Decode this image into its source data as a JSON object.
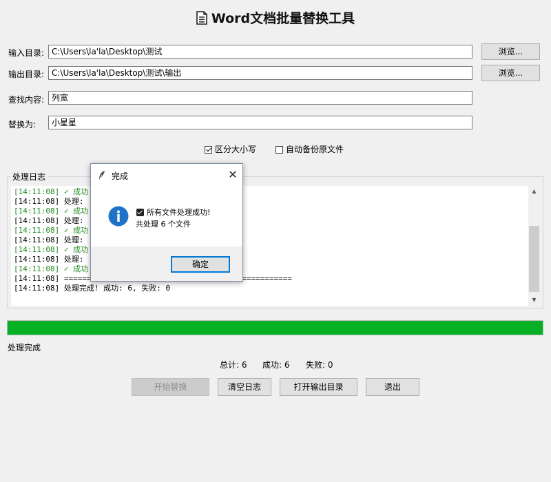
{
  "header": {
    "title": "Word文档批量替换工具",
    "icon": "document-icon"
  },
  "form": {
    "input_dir": {
      "label": "输入目录:",
      "value": "C:\\Users\\la'la\\Desktop\\测试"
    },
    "output_dir": {
      "label": "输出目录:",
      "value": "C:\\Users\\la'la\\Desktop\\测试\\输出"
    },
    "find": {
      "label": "查找内容:",
      "value": "列宽"
    },
    "replace": {
      "label": "替换为:",
      "value": "小星星"
    },
    "browse_label": "浏览...",
    "case_sensitive": {
      "label": "区分大小写",
      "checked": true
    },
    "auto_backup": {
      "label": "自动备份原文件",
      "checked": false
    }
  },
  "log": {
    "title": "处理日志",
    "lines": [
      {
        "time": "[14:11:08]",
        "text": " ✓ 成功",
        "kind": "ok"
      },
      {
        "time": "[14:11:08]",
        "text": " 处理:",
        "kind": "normal"
      },
      {
        "time": "[14:11:08]",
        "text": " ✓ 成功",
        "kind": "ok"
      },
      {
        "time": "[14:11:08]",
        "text": " 处理:",
        "kind": "normal"
      },
      {
        "time": "[14:11:08]",
        "text": " ✓ 成功",
        "kind": "ok"
      },
      {
        "time": "[14:11:08]",
        "text": " 处理:",
        "kind": "normal"
      },
      {
        "time": "[14:11:08]",
        "text": " ✓ 成功",
        "kind": "ok"
      },
      {
        "time": "[14:11:08]",
        "text": " 处理:",
        "kind": "normal"
      },
      {
        "time": "[14:11:08]",
        "text": " ✓ 成功",
        "kind": "ok"
      },
      {
        "time": "[14:11:08]",
        "text": " ==================================================",
        "kind": "normal"
      },
      {
        "time": "[14:11:08]",
        "text": " 处理完成! 成功: 6, 失败: 0",
        "kind": "normal"
      }
    ]
  },
  "progress": {
    "value": 1.0,
    "color": "#06b025"
  },
  "status": {
    "text": "处理完成"
  },
  "stats": {
    "total": "总计: 6",
    "success": "成功: 6",
    "failed": "失败: 0"
  },
  "buttons": {
    "start": "开始替换",
    "clear": "清空日志",
    "open_output": "打开输出目录",
    "exit": "退出"
  },
  "dialog": {
    "title": "完成",
    "line1": "所有文件处理成功!",
    "line2": "共处理 6 个文件",
    "ok": "确定",
    "icon": "info-icon"
  }
}
